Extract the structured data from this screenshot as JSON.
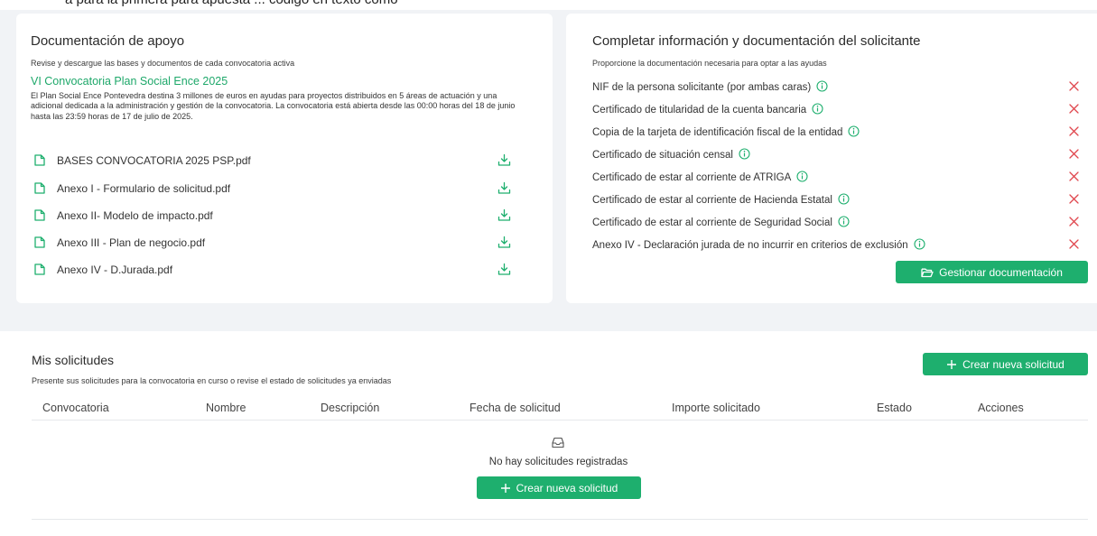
{
  "top_partial_text": "a para la primera para apuesta ... codigo en texto como",
  "documentacion": {
    "title": "Documentación de apoyo",
    "subtitle": "Revise y descargue las bases y documentos de cada convocatoria activa",
    "convocatoria_title": "VI Convocatoria Plan Social Ence 2025",
    "convocatoria_desc": "El Plan Social Ence Pontevedra destina 3 millones de euros en ayudas para proyectos distribuidos en 5 áreas de actuación y una adicional dedicada a la administración y gestión de la convocatoria. La convocatoria está abierta desde las 00:00 horas del 18 de junio hasta las 23:59 horas de 17 de julio de 2025.",
    "files": [
      {
        "name": "BASES CONVOCATORIA 2025 PSP.pdf",
        "icon": "file-icon",
        "action_icon": "download-icon"
      },
      {
        "name": "Anexo I - Formulario de solicitud.pdf",
        "icon": "file-icon",
        "action_icon": "download-icon"
      },
      {
        "name": "Anexo II- Modelo de impacto.pdf",
        "icon": "file-icon",
        "action_icon": "download-icon"
      },
      {
        "name": "Anexo III - Plan de negocio.pdf",
        "icon": "file-icon",
        "action_icon": "download-icon"
      },
      {
        "name": "Anexo IV - D.Jurada.pdf",
        "icon": "file-icon",
        "action_icon": "download-icon"
      }
    ]
  },
  "solicitante": {
    "title": "Completar información y documentación del solicitante",
    "subtitle": "Proporcione la documentación necesaria para optar a las ayudas",
    "requirements": [
      {
        "label": "NIF de la persona solicitante (por ambas caras)",
        "status": "missing"
      },
      {
        "label": "Certificado de titularidad de la cuenta bancaria",
        "status": "missing"
      },
      {
        "label": "Copia de la tarjeta de identificación fiscal de la entidad",
        "status": "missing"
      },
      {
        "label": "Certificado de situación censal",
        "status": "missing"
      },
      {
        "label": "Certificado de estar al corriente de ATRIGA",
        "status": "missing"
      },
      {
        "label": "Certificado de estar al corriente de Hacienda Estatal",
        "status": "missing"
      },
      {
        "label": "Certificado de estar al corriente de Seguridad Social",
        "status": "missing"
      },
      {
        "label": "Anexo IV - Declaración jurada de no incurrir en criterios de exclusión",
        "status": "missing"
      }
    ],
    "manage_button": "Gestionar documentación"
  },
  "solicitudes": {
    "title": "Mis solicitudes",
    "subtitle": "Presente sus solicitudes para la convocatoria en curso o revise el estado de solicitudes ya enviadas",
    "create_button": "Crear nueva solicitud",
    "columns": [
      "Convocatoria",
      "Nombre",
      "Descripción",
      "Fecha de solicitud",
      "Importe solicitado",
      "Estado",
      "Acciones"
    ],
    "rows": [],
    "empty_text": "No hay solicitudes registradas",
    "empty_create_button": "Crear nueva solicitud"
  },
  "colors": {
    "accent": "#1eaf6e",
    "missing": "#e0484f",
    "info": "#1eaf6e",
    "background": "#f1f3f6"
  }
}
